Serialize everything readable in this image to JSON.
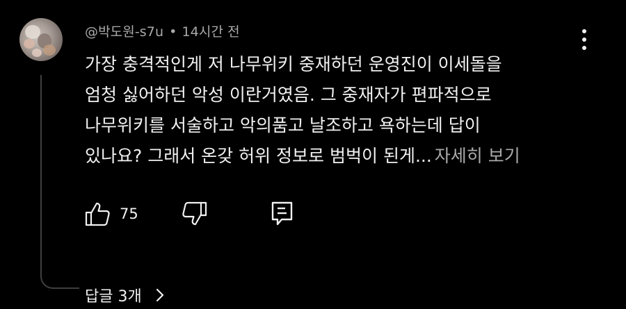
{
  "comment": {
    "author": "@박도원-s7u",
    "separator": "•",
    "timestamp": "14시간 전",
    "lines": [
      "가장 충격적인게 저 나무위키 중재하던 운영진이 이세돌을",
      "엄청 싫어하던 악성 이란거였음. 그 중재자가 편파적으로",
      "나무위키를 서술하고 악의품고 날조하고 욕하는데 답이",
      "있나요? 그래서 온갖 허위 정보로 범벅이 된게..."
    ],
    "read_more": "자세히 보기",
    "like_count": "75",
    "replies_label": "답글 3개"
  },
  "icons": {
    "menu": "more-vert-icon",
    "like": "thumb-up-icon",
    "dislike": "thumb-down-icon",
    "reply": "reply-comment-icon",
    "replies_expand": "chevron-right-icon"
  },
  "colors": {
    "background": "#000000",
    "primary_text": "#f1f1f1",
    "secondary_text": "#aaaaaa",
    "thread_line": "#3f3f3f"
  }
}
